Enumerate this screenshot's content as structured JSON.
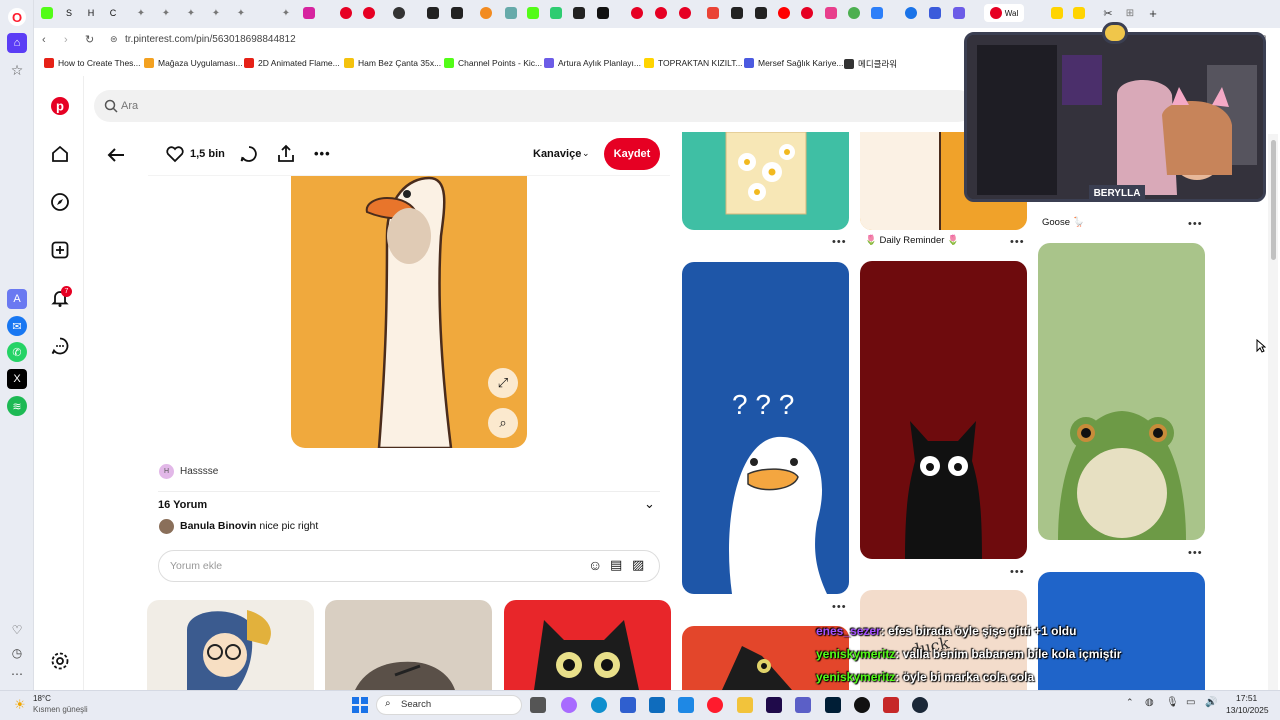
{
  "browser": {
    "url": "tr.pinterest.com/pin/563018698844812",
    "tabs": [
      {
        "label": "S",
        "color": "#53c41a"
      },
      {
        "label": "H",
        "color": "#888888"
      },
      {
        "label": "C",
        "color": "#4a6cf7"
      },
      {
        "label": "",
        "color": "#888888"
      },
      {
        "label": "",
        "color": "#888888"
      },
      {
        "label": "",
        "color": "#888888"
      },
      {
        "label": "",
        "color": "#888888"
      },
      {
        "label": "",
        "color": "#888888"
      },
      {
        "label": "",
        "color": "#a451ff"
      },
      {
        "label": "",
        "color": "#d3286c"
      },
      {
        "label": "Wal",
        "color": "#e60023"
      }
    ],
    "bookmarks": [
      {
        "label": "How to Create Thes...",
        "color": "#e62117"
      },
      {
        "label": "Mağaza Uygulaması...",
        "color": "#f3a120"
      },
      {
        "label": "2D Animated Flame...",
        "color": "#e62117"
      },
      {
        "label": "Ham Bez Çanta 35x...",
        "color": "#f4c20d"
      },
      {
        "label": "Channel Points - Kic...",
        "color": "#53fc18"
      },
      {
        "label": "Artura Aylık Planlayı...",
        "color": "#6c5ce7"
      },
      {
        "label": "TOPRAKTAN KIZILT...",
        "color": "#ffd400"
      },
      {
        "label": "Mersef Sağlık Kariye...",
        "color": "#4b5ae0"
      },
      {
        "label": "메디클라워",
        "color": "#333333"
      }
    ]
  },
  "pinterest": {
    "search_placeholder": "Ara",
    "notification_count": "7",
    "pin": {
      "likes": "1,5 bin",
      "board": "Kanaviçe",
      "save_label": "Kaydet",
      "author": "Hasssse",
      "author_initial": "H",
      "comments_count_label": "16 Yorum",
      "first_comment_user": "Banula Binovin",
      "first_comment_text": "nice pic right",
      "comment_placeholder": "Yorum ekle"
    },
    "grid": {
      "captions": {
        "goose": "Goose 🪿",
        "daily": "🌷 Daily Reminder 🌷"
      }
    }
  },
  "stream": {
    "webcam_name": "BERYLLA",
    "chat": [
      {
        "user": "enes_sezer",
        "user_color": "#a451ff",
        "text": ": efes birada öyle şişe gitti +1 oldu"
      },
      {
        "user": "yeniskymeritz",
        "user_color": "#53fc18",
        "text": ": valla benim babanem bile kola içmiştir"
      },
      {
        "user": "yeniskymeritz",
        "user_color": "#53fc18",
        "text": ": öyle bi marka cola cola"
      }
    ]
  },
  "taskbar": {
    "weather_temp": "18°C",
    "weather_desc": "Kısmen güneşli",
    "search_label": "Search",
    "time": "17:51",
    "date": "13/10/2025"
  }
}
